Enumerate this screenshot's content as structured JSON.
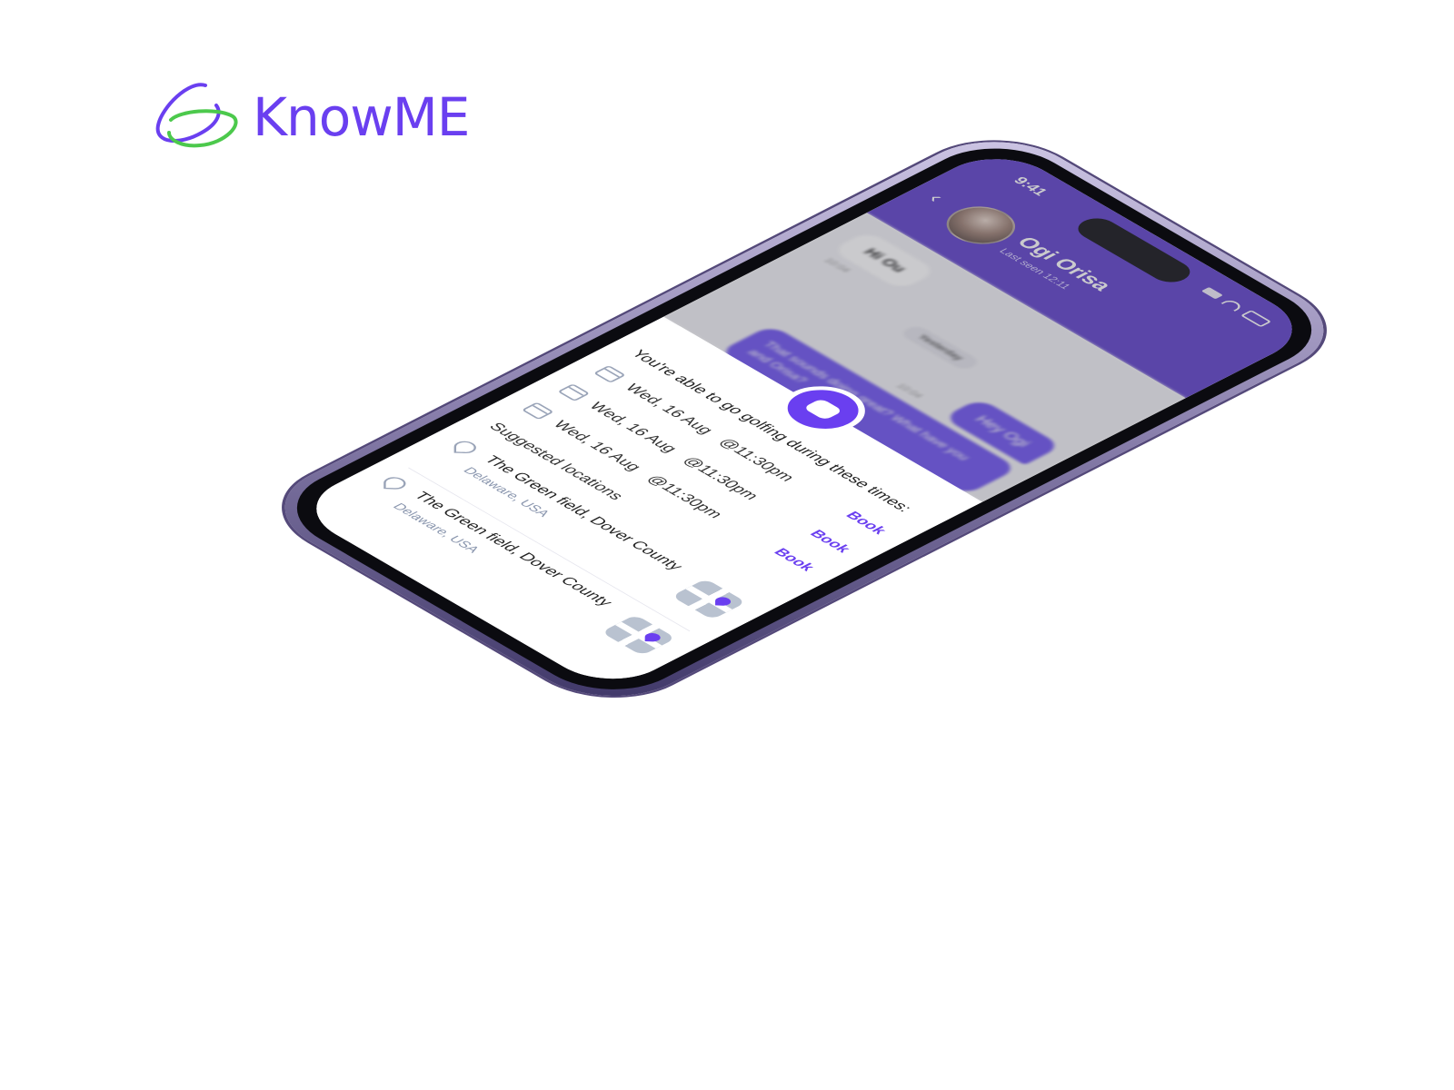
{
  "brand": {
    "name": "KnowME",
    "mark_color_1": "#6a3ff0",
    "mark_color_2": "#4cc94c"
  },
  "status_bar": {
    "time": "9:41"
  },
  "chat": {
    "contact_name": "Ogi Orisa",
    "contact_status": "Last seen 12:11",
    "incoming_message": "Hi Ou",
    "incoming_time": "10:04",
    "day_chip": "Yesterday",
    "outgoing_message": "Hey Ogi",
    "outgoing_time": "10:04",
    "outgoing_message_2": "That sounds doing great? What have you and Orisa?"
  },
  "sheet": {
    "title": "You're able to go golfing during these times:",
    "times": [
      {
        "date": "Wed, 16 Aug",
        "time": "@11:30pm",
        "action": "Book"
      },
      {
        "date": "Wed, 16 Aug",
        "time": "@11:30pm",
        "action": "Book"
      },
      {
        "date": "Wed, 16 Aug",
        "time": "@11:30pm",
        "action": "Book"
      }
    ],
    "locations_label": "Suggested locations",
    "locations": [
      {
        "name": "The Green field, Dover County",
        "region": "Delaware, USA"
      },
      {
        "name": "The Green field, Dover County",
        "region": "Delaware, USA"
      }
    ]
  },
  "colors": {
    "accent": "#6a3ff0",
    "header": "#5a3cc9"
  }
}
